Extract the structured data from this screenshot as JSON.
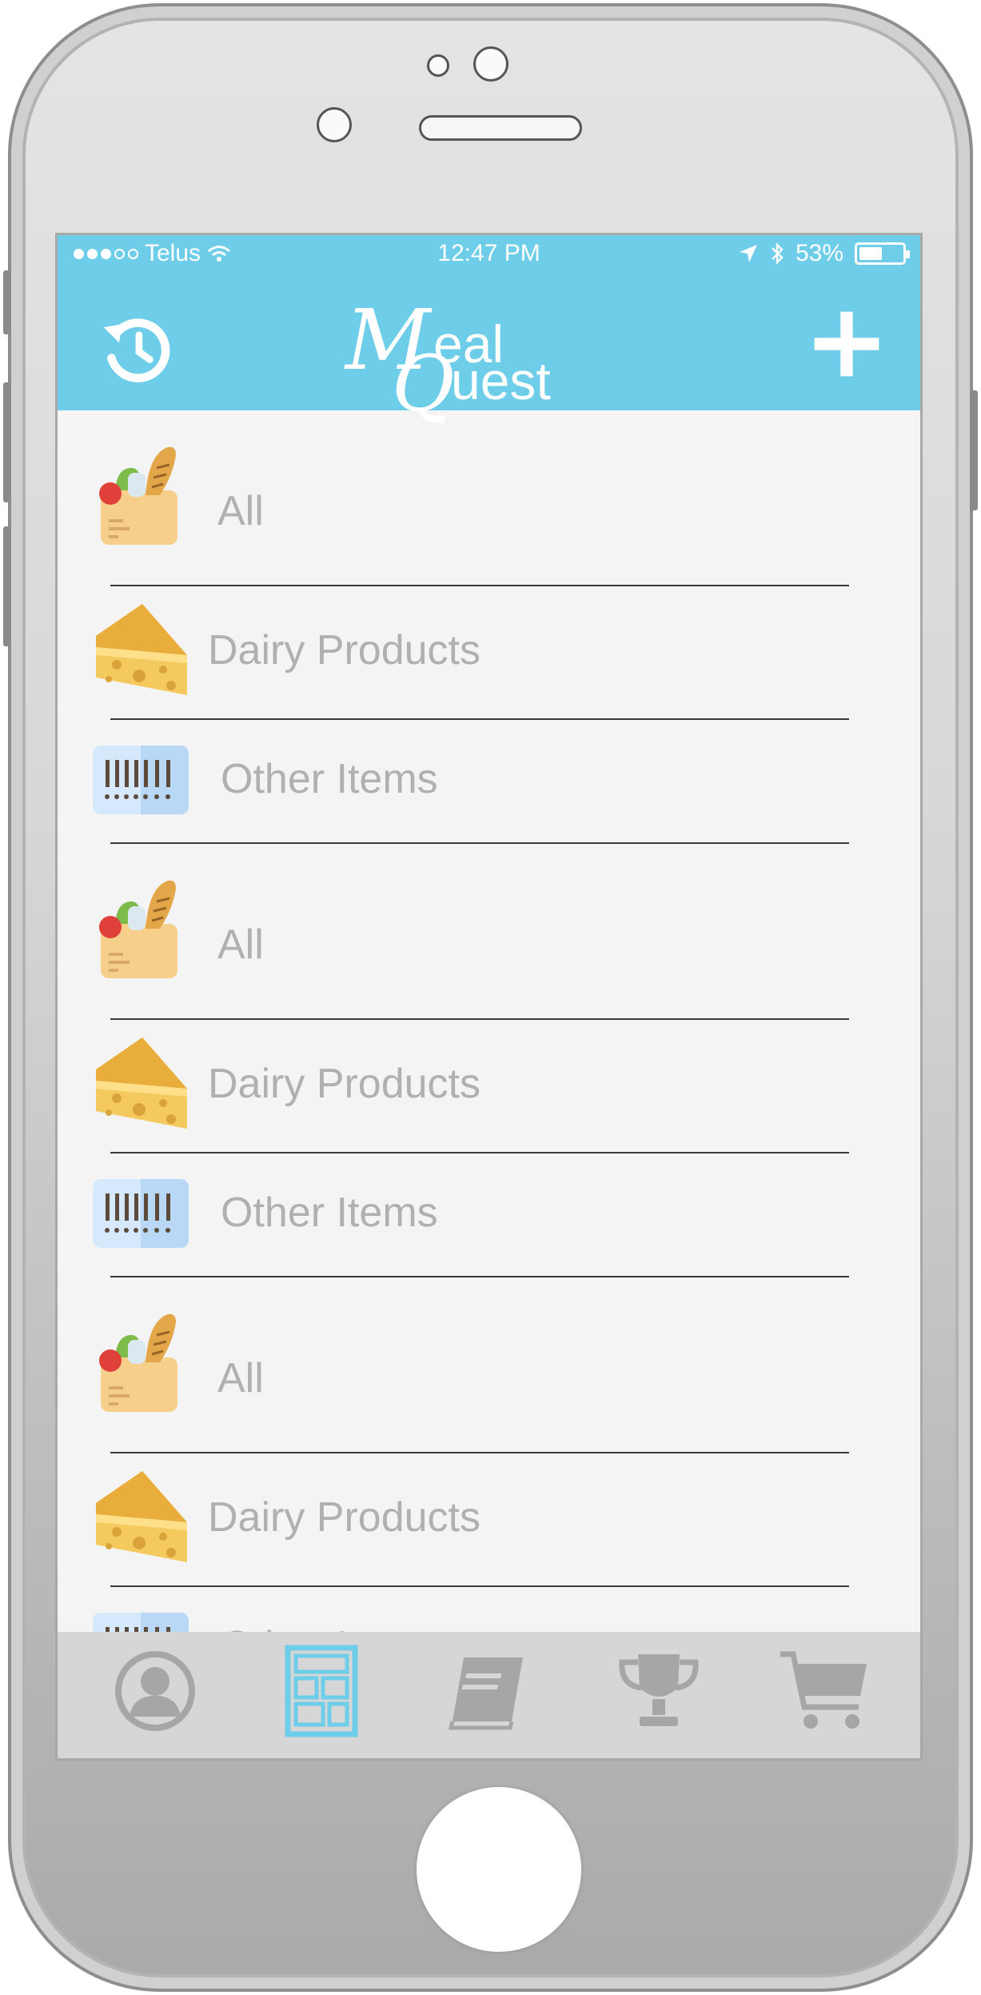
{
  "status_bar": {
    "carrier": "Telus",
    "time": "12:47 PM",
    "battery": "53%",
    "battery_level": 0.53
  },
  "header": {
    "logo_line1": "eal",
    "logo_line2": "uest",
    "history_icon": "history-icon",
    "add_icon": "plus-icon"
  },
  "list": {
    "items": [
      {
        "label": "All",
        "icon": "grocery-bag-icon"
      },
      {
        "label": "Dairy Products",
        "icon": "cheese-icon"
      },
      {
        "label": "Other Items",
        "icon": "barcode-icon"
      },
      {
        "label": "All",
        "icon": "grocery-bag-icon"
      },
      {
        "label": "Dairy Products",
        "icon": "cheese-icon"
      },
      {
        "label": "Other Items",
        "icon": "barcode-icon"
      },
      {
        "label": "All",
        "icon": "grocery-bag-icon"
      },
      {
        "label": "Dairy Products",
        "icon": "cheese-icon"
      },
      {
        "label": "Other Items",
        "icon": "barcode-icon"
      }
    ]
  },
  "tabbar": {
    "tabs": [
      {
        "name": "profile",
        "icon": "profile-icon",
        "active": false
      },
      {
        "name": "pantry",
        "icon": "pantry-shelf-icon",
        "active": true
      },
      {
        "name": "recipes",
        "icon": "book-icon",
        "active": false
      },
      {
        "name": "achievements",
        "icon": "trophy-icon",
        "active": false
      },
      {
        "name": "cart",
        "icon": "cart-icon",
        "active": false
      }
    ]
  },
  "colors": {
    "header": "#6ecde9",
    "active_tab": "#6ecde9",
    "inactive_tab": "#a6a6a6",
    "label": "#b0b0b0"
  }
}
